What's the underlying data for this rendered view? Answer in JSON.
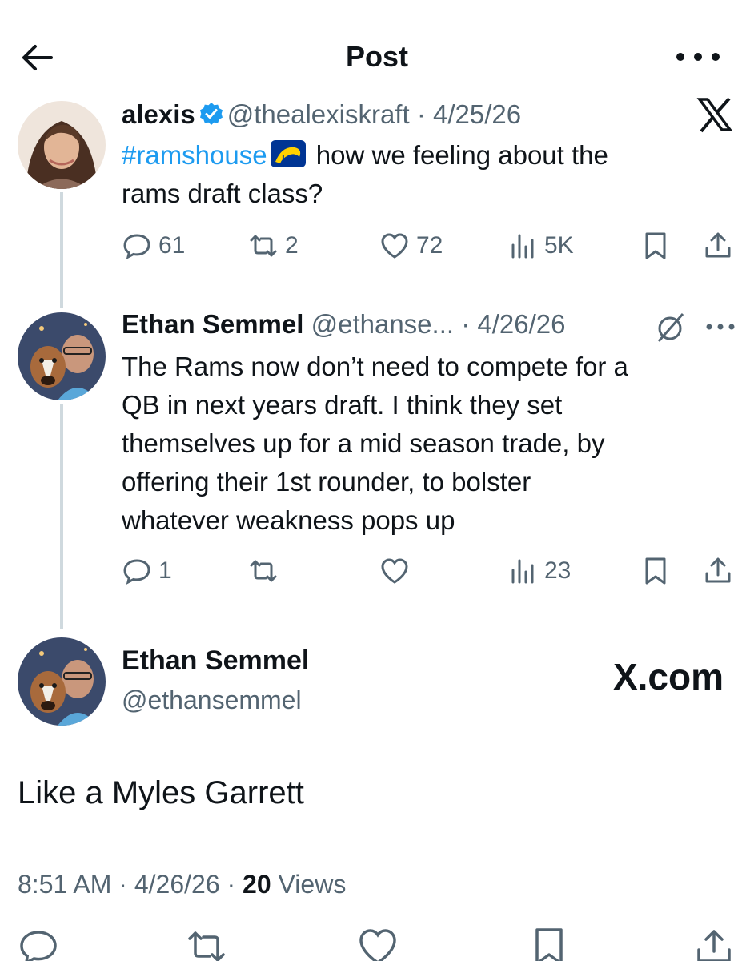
{
  "header": {
    "title": "Post"
  },
  "tweets": [
    {
      "name": "alexis",
      "handle": "@thealexiskraft",
      "date": "4/25/26",
      "hashtag": "#ramshouse",
      "text_line1": "how we feeling about the",
      "text_line2": "rams draft class?",
      "replies": "61",
      "reposts": "2",
      "likes": "72",
      "views": "5K"
    },
    {
      "name": "Ethan Semmel",
      "handle": "@ethanse...",
      "date": "4/26/26",
      "lines": [
        "The Rams now don’t need to compete for a",
        "QB in next years draft. I think they set",
        "themselves up for a mid season trade, by",
        "offering their 1st rounder, to bolster",
        "whatever weakness pops up"
      ],
      "replies": "1",
      "views": "23"
    }
  ],
  "main": {
    "name": "Ethan Semmel",
    "handle": "@ethansemmel",
    "watermark": "X.com",
    "text": "Like a Myles Garrett",
    "time": "8:51 AM",
    "date": "4/26/26",
    "views_count": "20",
    "views_label": "Views"
  },
  "separator": "·",
  "colors": {
    "link": "#1d9bf0",
    "muted": "#536471",
    "text": "#0f1419"
  }
}
